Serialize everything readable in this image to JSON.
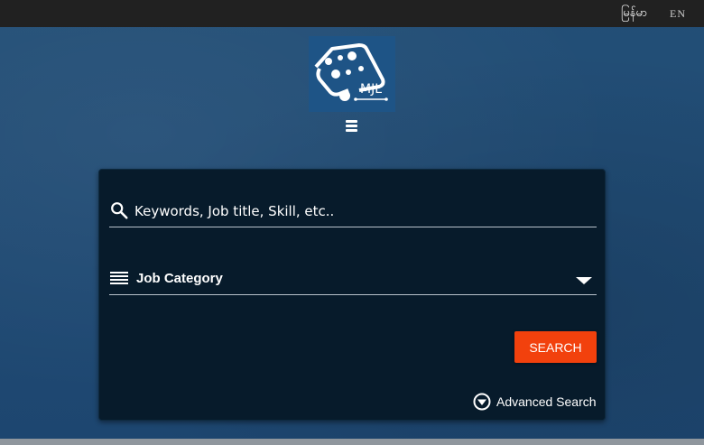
{
  "topbar": {
    "lang_myanmar": "မြန်မာ",
    "lang_english": "EN"
  },
  "header": {
    "logo_text": "MJL",
    "menu_icon": "hamburger-icon"
  },
  "search_form": {
    "keyword_placeholder": "Keywords, Job title, Skill, etc..",
    "keyword_value": "",
    "keyword_icon": "search-icon",
    "category_label": "Job Category",
    "category_icon": "list-icon",
    "search_button": "SEARCH",
    "advanced_label": "Advanced Search",
    "advanced_icon": "chevron-circle-down-icon"
  },
  "colors": {
    "background": "#1f4a71",
    "topbar": "#212121",
    "card": "#071b2b",
    "accent": "#f2410d"
  }
}
